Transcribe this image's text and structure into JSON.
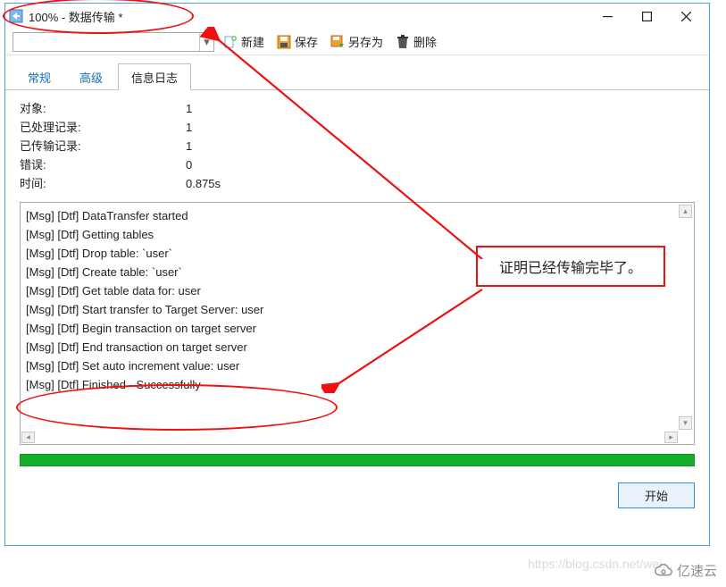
{
  "titlebar": {
    "title": "100% - 数据传输 *"
  },
  "toolbar": {
    "new_label": "新建",
    "save_label": "保存",
    "saveas_label": "另存为",
    "delete_label": "删除"
  },
  "tabs": {
    "general": "常规",
    "advanced": "高级",
    "log": "信息日志"
  },
  "stats": {
    "objects_label": "对象:",
    "objects_val": "1",
    "processed_label": "已处理记录:",
    "processed_val": "1",
    "transferred_label": "已传输记录:",
    "transferred_val": "1",
    "errors_label": "错误:",
    "errors_val": "0",
    "time_label": "时间:",
    "time_val": "0.875s"
  },
  "log_lines": [
    "[Msg] [Dtf] DataTransfer started",
    "[Msg] [Dtf] Getting tables",
    "[Msg] [Dtf] Drop table: `user`",
    "[Msg] [Dtf] Create table: `user`",
    "[Msg] [Dtf] Get table data for: user",
    "[Msg] [Dtf] Start transfer to Target Server: user",
    "[Msg] [Dtf] Begin transaction on target server",
    "[Msg] [Dtf] End transaction on target server",
    "[Msg] [Dtf] Set auto increment value: user",
    "[Msg] [Dtf] Finished - Successfully"
  ],
  "footer": {
    "start_label": "开始"
  },
  "annotation": {
    "note": "证明已经传输完毕了。"
  },
  "brand": {
    "name": "亿速云"
  }
}
